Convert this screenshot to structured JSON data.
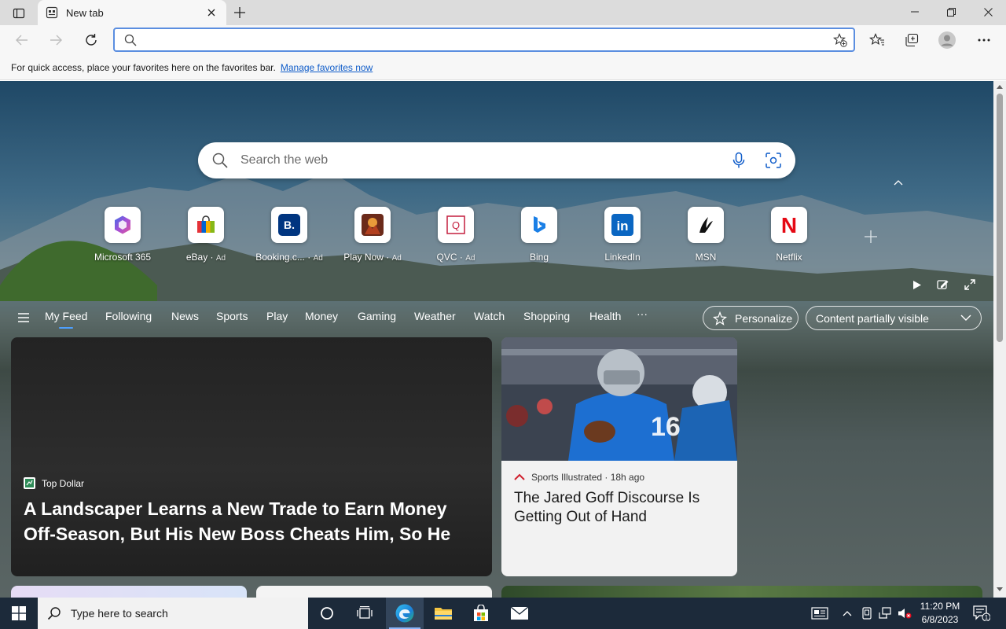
{
  "browser": {
    "tab_title": "New tab",
    "address_value": "",
    "favorites_bar": {
      "message": "For quick access, place your favorites here on the favorites bar.",
      "link": "Manage favorites now"
    }
  },
  "newtab": {
    "search_placeholder": "Search the web",
    "quick_links": [
      {
        "label": "Microsoft 365",
        "ad": ""
      },
      {
        "label": "eBay",
        "ad": "Ad"
      },
      {
        "label": "Booking.c...",
        "ad": "Ad"
      },
      {
        "label": "Play Now",
        "ad": "Ad"
      },
      {
        "label": "QVC",
        "ad": "Ad"
      },
      {
        "label": "Bing",
        "ad": ""
      },
      {
        "label": "LinkedIn",
        "ad": ""
      },
      {
        "label": "MSN",
        "ad": ""
      },
      {
        "label": "Netflix",
        "ad": ""
      }
    ],
    "tile_glyphs": {
      "booking": "B.",
      "qvc": "Q",
      "linkedin": "in",
      "netflix": "N"
    },
    "feed_tabs": [
      "My Feed",
      "Following",
      "News",
      "Sports",
      "Play",
      "Money",
      "Gaming",
      "Weather",
      "Watch",
      "Shopping",
      "Health"
    ],
    "feed_more": "···",
    "personalize_label": "Personalize",
    "content_select_value": "Content partially visible",
    "cards": [
      {
        "source": "Top Dollar",
        "headline": "A Landscaper Learns a New Trade to Earn Money Off-Season, But His New Boss Cheats Him, So He Strike..."
      },
      {
        "source": "Sports Illustrated · 18h ago",
        "headline": "The Jared Goff Discourse Is Getting Out of Hand"
      }
    ]
  },
  "taskbar": {
    "search_placeholder": "Type here to search",
    "time": "11:20 PM",
    "date": "6/8/2023",
    "notification_count": "1"
  }
}
